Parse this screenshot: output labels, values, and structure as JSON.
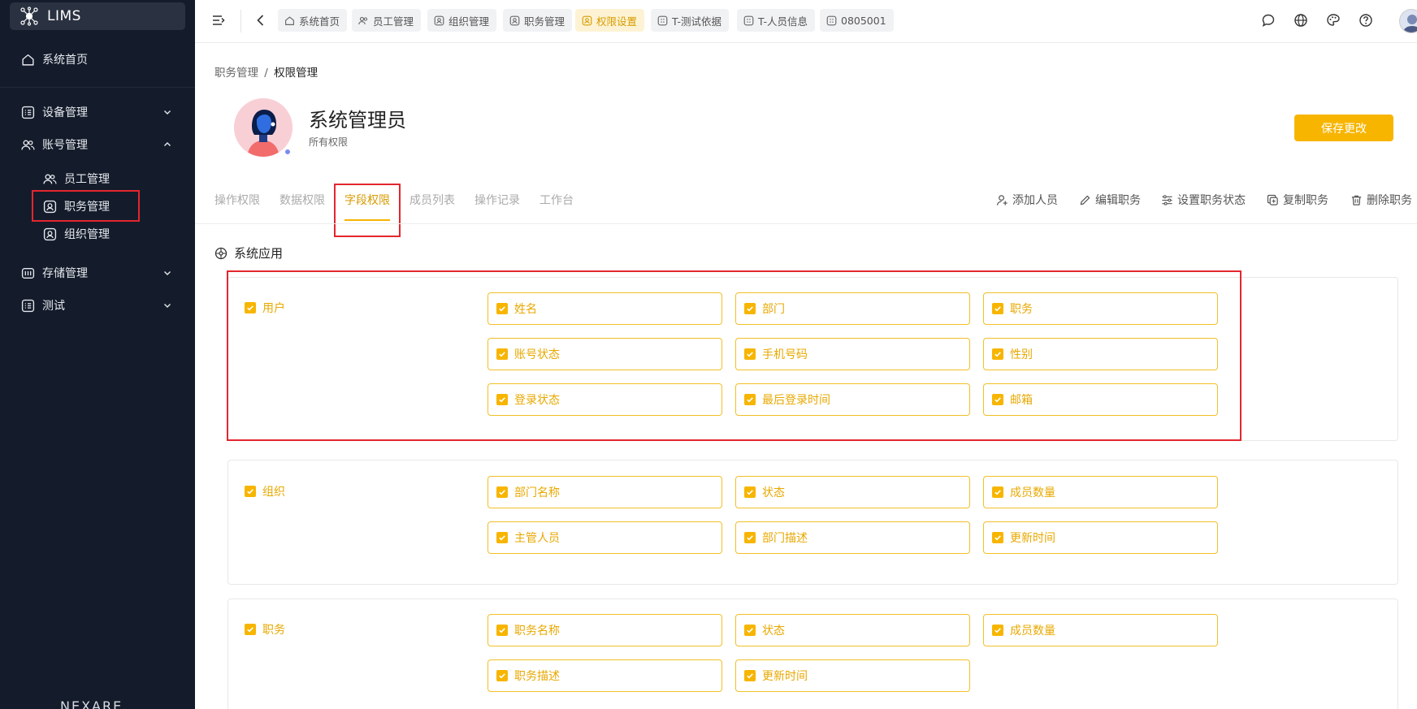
{
  "sidebar": {
    "logo_text": "LIMS",
    "items": [
      {
        "label": "系统首页",
        "icon": "home-icon"
      },
      {
        "label": "设备管理",
        "icon": "grid-list-icon"
      },
      {
        "label": "账号管理",
        "icon": "users-icon"
      },
      {
        "label": "员工管理",
        "icon": "users-icon"
      },
      {
        "label": "职务管理",
        "icon": "id-badge-icon"
      },
      {
        "label": "组织管理",
        "icon": "id-badge-icon"
      },
      {
        "label": "存储管理",
        "icon": "storage-icon"
      },
      {
        "label": "测试",
        "icon": "grid-list-icon"
      }
    ],
    "footer_text": "NEXARE"
  },
  "topbar": {
    "tags": [
      {
        "label": "系统首页",
        "icon": "home-icon"
      },
      {
        "label": "员工管理",
        "icon": "users-icon"
      },
      {
        "label": "组织管理",
        "icon": "id-badge-icon"
      },
      {
        "label": "职务管理",
        "icon": "id-badge-icon"
      },
      {
        "label": "权限设置",
        "icon": "id-badge-icon",
        "active": true
      },
      {
        "label": "T-测试依据",
        "icon": "grid-icon"
      },
      {
        "label": "T-人员信息",
        "icon": "grid-icon"
      },
      {
        "label": "0805001",
        "icon": "grid-icon"
      }
    ]
  },
  "breadcrumb": {
    "parent": "职务管理",
    "separator": "/",
    "current": "权限管理"
  },
  "role": {
    "title": "系统管理员",
    "subtitle": "所有权限"
  },
  "save_label": "保存更改",
  "tabs": [
    "操作权限",
    "数据权限",
    "字段权限",
    "成员列表",
    "操作记录",
    "工作台"
  ],
  "active_tab": "字段权限",
  "actions": [
    {
      "label": "添加人员",
      "icon": "add-user-icon"
    },
    {
      "label": "编辑职务",
      "icon": "pencil-icon"
    },
    {
      "label": "设置职务状态",
      "icon": "sliders-icon"
    },
    {
      "label": "复制职务",
      "icon": "copy-icon"
    },
    {
      "label": "删除职务",
      "icon": "trash-icon"
    }
  ],
  "section_title": "系统应用",
  "groups": [
    {
      "name": "用户",
      "fields": [
        "姓名",
        "部门",
        "职务",
        "账号状态",
        "手机号码",
        "性别",
        "登录状态",
        "最后登录时间",
        "邮箱"
      ]
    },
    {
      "name": "组织",
      "fields": [
        "部门名称",
        "状态",
        "成员数量",
        "主管人员",
        "部门描述",
        "更新时间"
      ]
    },
    {
      "name": "职务",
      "fields": [
        "职务名称",
        "状态",
        "成员数量",
        "职务描述",
        "更新时间"
      ]
    }
  ],
  "colors": {
    "accent": "#f7b500",
    "sidebar_bg": "#141c2b",
    "highlight_red": "#e3262e"
  }
}
